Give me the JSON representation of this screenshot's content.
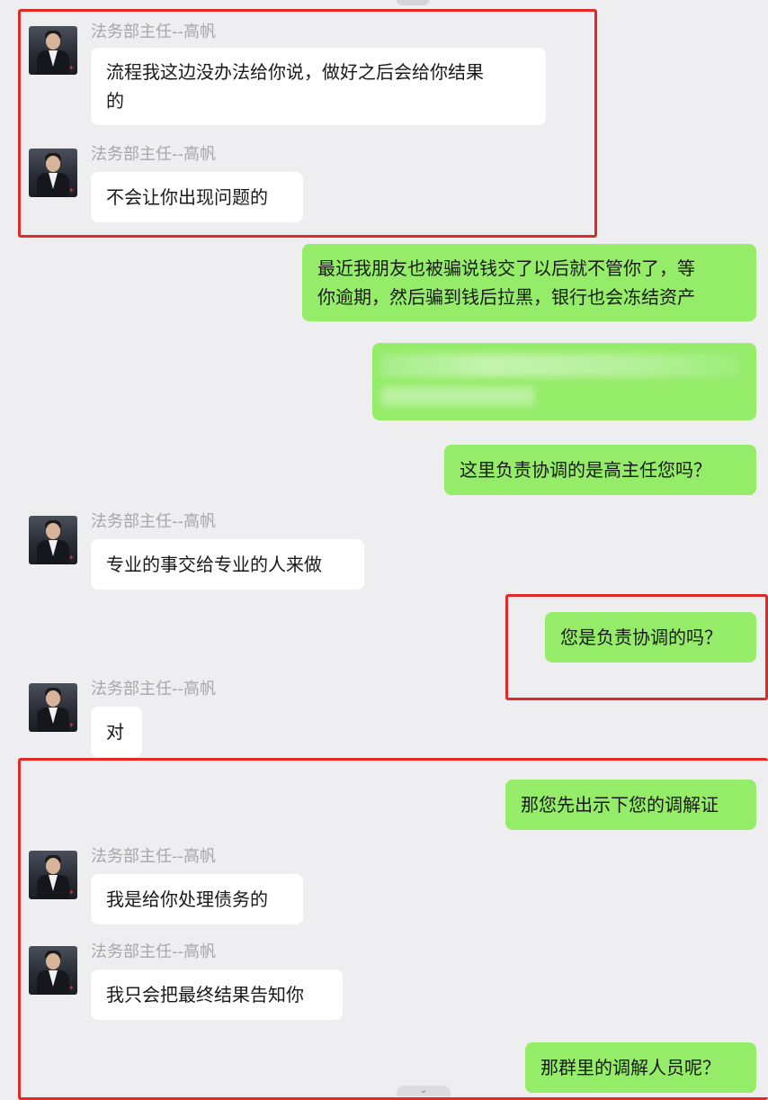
{
  "chat": {
    "messages": [
      {
        "sender": "法务部主任--高帆",
        "lines": [
          "流程我这边没办法给你说，做好之后会给你结果",
          "的"
        ]
      },
      {
        "sender": "法务部主任--高帆",
        "lines": [
          "不会让你出现问题的"
        ]
      },
      {
        "lines": [
          "最近我朋友也被骗说钱交了以后就不管你了，等",
          "你逾期，然后骗到钱后拉黑，银行也会冻结资产"
        ]
      },
      {
        "lines": [
          "这里负责协调的是高主任您吗？"
        ]
      },
      {
        "sender": "法务部主任--高帆",
        "lines": [
          "专业的事交给专业的人来做"
        ]
      },
      {
        "lines": [
          "您是负责协调的吗？"
        ]
      },
      {
        "sender": "法务部主任--高帆",
        "lines": [
          "对"
        ]
      },
      {
        "lines": [
          "那您先出示下您的调解证"
        ]
      },
      {
        "sender": "法务部主任--高帆",
        "lines": [
          "我是给你处理债务的"
        ]
      },
      {
        "sender": "法务部主任--高帆",
        "lines": [
          "我只会把最终结果告知你"
        ]
      },
      {
        "lines": [
          "那群里的调解人员呢？"
        ]
      }
    ]
  },
  "colors": {
    "incoming_bubble": "#ffffff",
    "outgoing_bubble": "#95ec69",
    "highlight_box": "#e02a2a",
    "background": "#eeeef0"
  },
  "icons": {
    "avatar": "avatar-man-in-suit",
    "scroll_down": "chevron-down-icon"
  }
}
